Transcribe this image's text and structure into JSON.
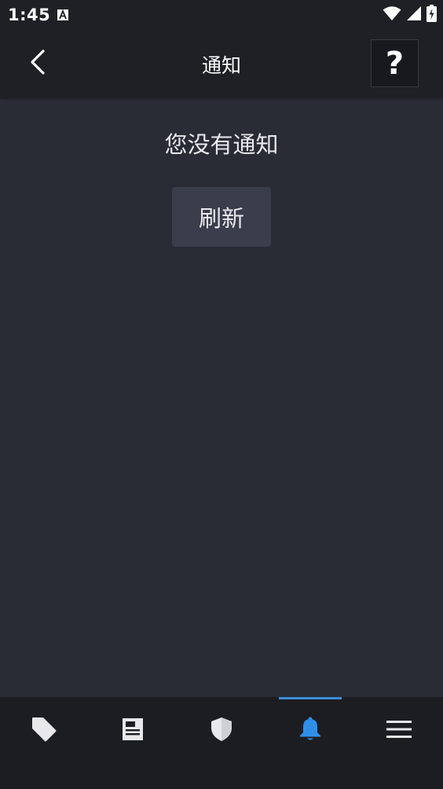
{
  "status_bar": {
    "time": "1:45",
    "icons": [
      "app-notification-icon",
      "wifi-icon",
      "signal-icon",
      "battery-charging-icon"
    ]
  },
  "app_bar": {
    "title": "通知",
    "back_icon": "chevron-left-icon",
    "help_label": "?"
  },
  "content": {
    "empty_message": "您没有通知",
    "refresh_label": "刷新"
  },
  "bottom_nav": {
    "items": [
      {
        "icon": "tag-icon"
      },
      {
        "icon": "news-icon"
      },
      {
        "icon": "shield-icon"
      },
      {
        "icon": "bell-icon",
        "active": true
      },
      {
        "icon": "menu-icon"
      }
    ],
    "active_color": "#2f8fe8",
    "inactive_color": "#e8e8ea"
  },
  "colors": {
    "background": "#292c35",
    "bar": "#1f2025",
    "button": "#3a3d4a",
    "accent": "#3d8ddb"
  }
}
